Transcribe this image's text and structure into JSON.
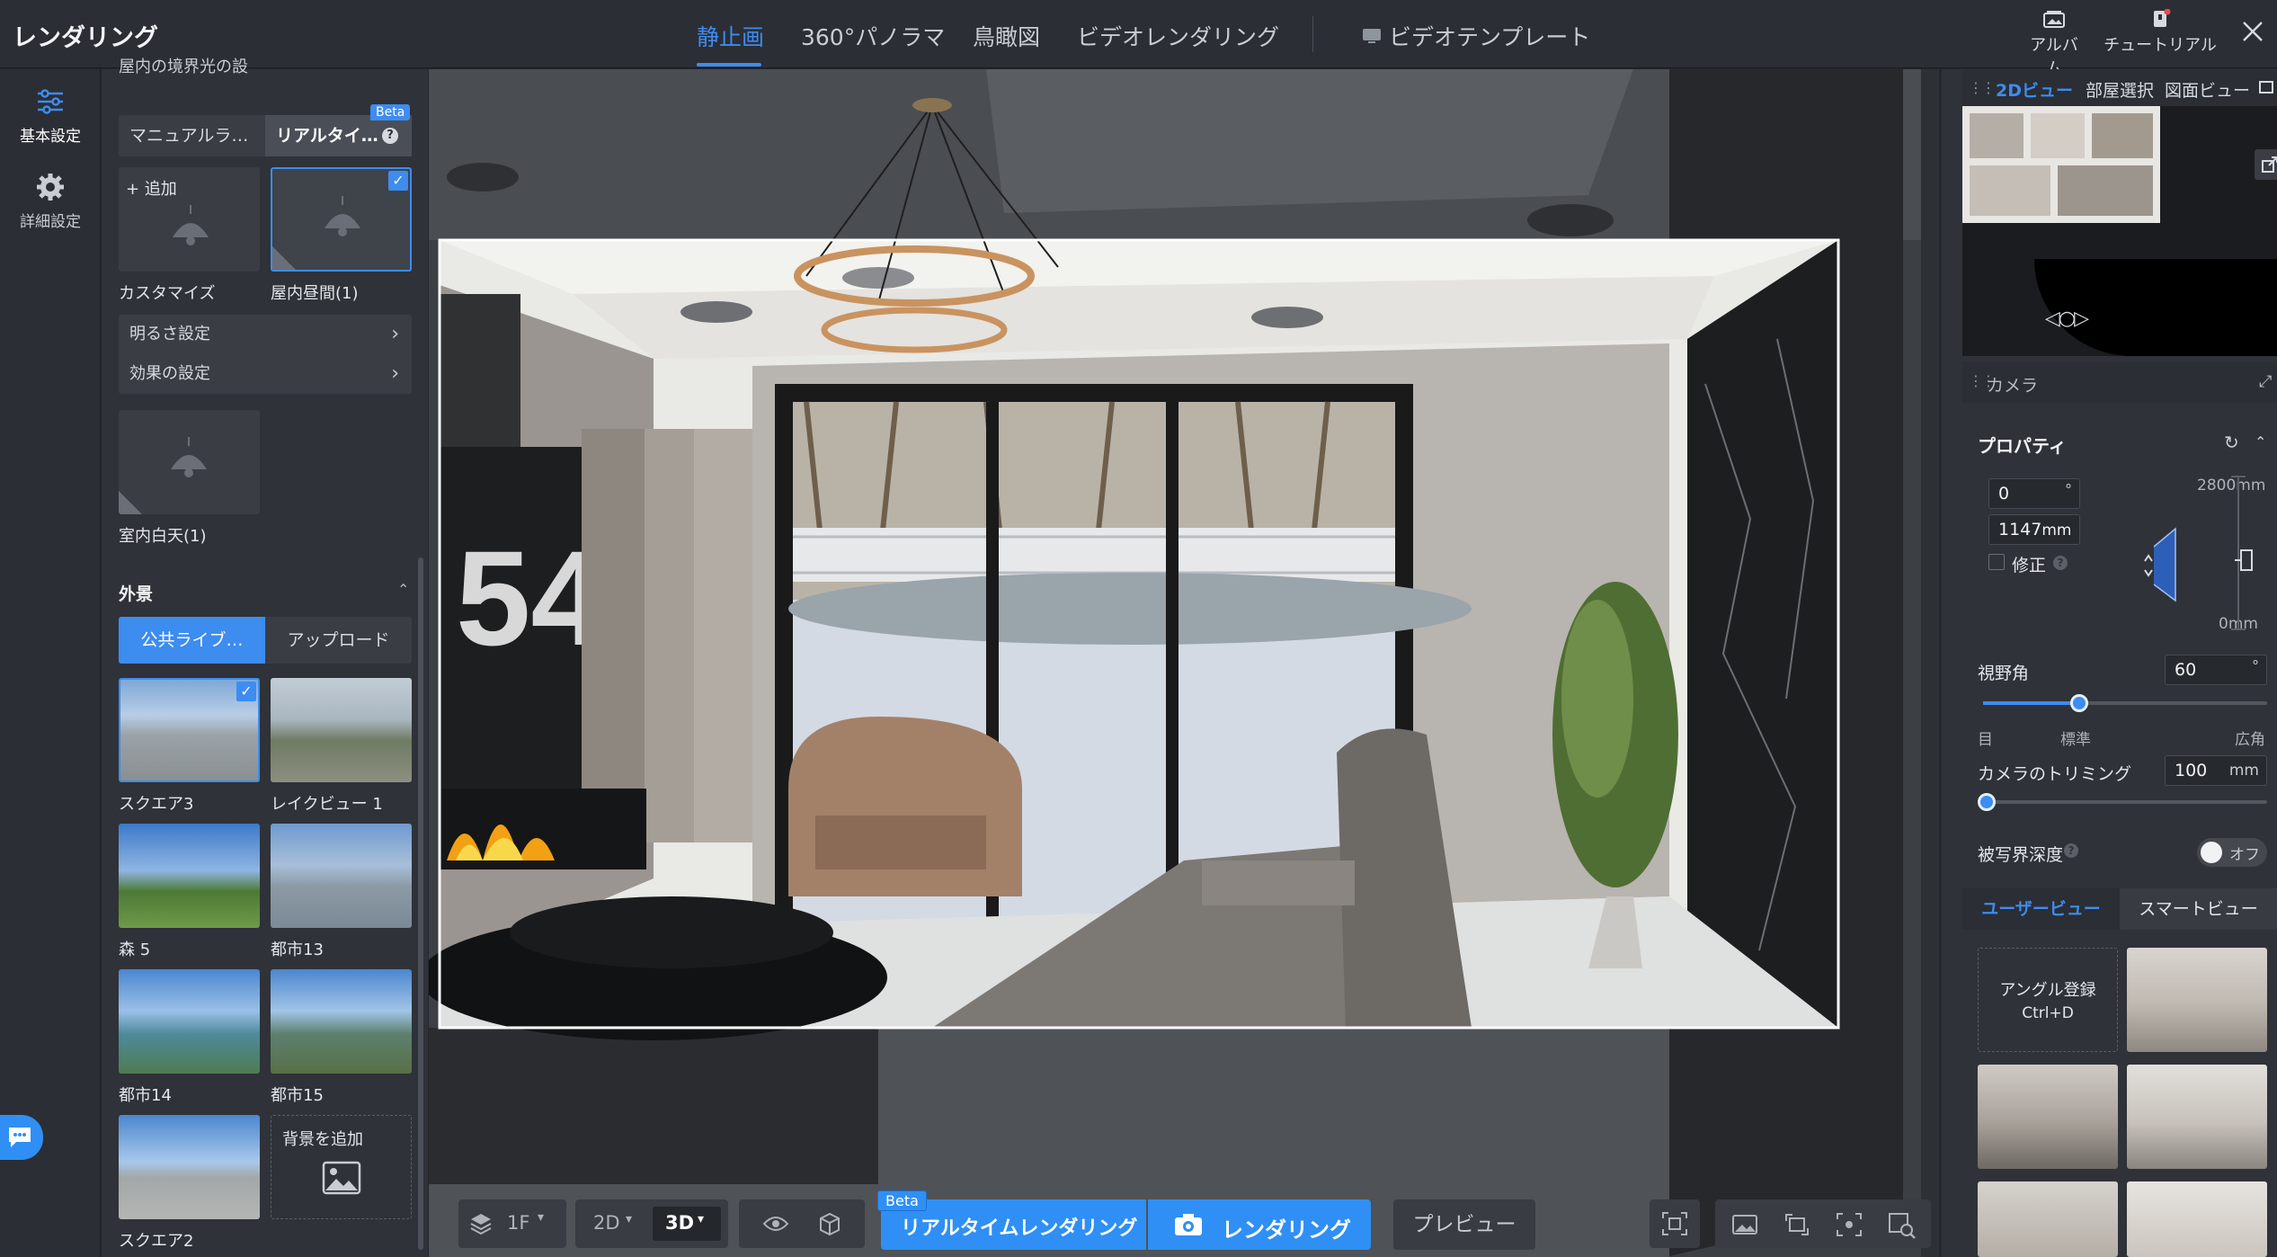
{
  "app": {
    "title": "レンダリング"
  },
  "top_tabs": [
    "静止画",
    "360°パノラマ",
    "鳥瞰図",
    "ビデオレンダリング"
  ],
  "video_template": "ビデオテンプレート",
  "top_right": {
    "album": "アルバム",
    "tutorial": "チュートリアル"
  },
  "rail": {
    "basic": "基本設定",
    "advanced": "詳細設定"
  },
  "left_panel": {
    "cut_heading": "屋内の境界光の設",
    "light_modes": {
      "manual": "マニュアルラ…",
      "realtime": "リアルタイ…",
      "beta": "Beta"
    },
    "add_label": "+ 追加",
    "presets": [
      {
        "label": "カスタマイズ"
      },
      {
        "label": "屋内昼間(1)"
      },
      {
        "label": "室内白天(1)"
      }
    ],
    "menus": [
      "明るさ設定",
      "効果の設定"
    ],
    "exterior_heading": "外景",
    "exterior_tabs": {
      "public": "公共ライブ…",
      "upload": "アップロード"
    },
    "backgrounds": [
      {
        "label": "スクエア3"
      },
      {
        "label": "レイクビュー 1"
      },
      {
        "label": "森 5"
      },
      {
        "label": "都市13"
      },
      {
        "label": "都市14"
      },
      {
        "label": "都市15"
      },
      {
        "label": "スクエア2"
      }
    ],
    "add_background": "背景を追加"
  },
  "right_panel": {
    "view_tabs": [
      "2Dビュー",
      "部屋選択",
      "図面ビュー"
    ],
    "camera_heading": "カメラ",
    "properties_heading": "プロパティ",
    "angle_value": "0",
    "angle_unit": "°",
    "height_value": "1147",
    "height_unit": "mm",
    "top_height": "2800mm",
    "bottom_height": "0mm",
    "correction_label": "修正",
    "fov_label": "視野角",
    "fov_value": "60",
    "fov_unit": "°",
    "fov_fraction": 0.34,
    "fov_marks": [
      "目",
      "標準",
      "広角"
    ],
    "trim_label": "カメラのトリミング",
    "trim_value": "100",
    "trim_unit": "mm",
    "trim_fraction": 0.0,
    "dof_label": "被写界深度",
    "dof_toggle": "オフ",
    "view_mode_tabs": {
      "user": "ユーザービュー",
      "smart": "スマートビュー"
    },
    "register_angle": "アングル登録",
    "register_shortcut": "Ctrl+D"
  },
  "bottom_bar": {
    "floor": "1F",
    "mode_2d": "2D",
    "mode_3d": "3D",
    "beta": "Beta",
    "realtime_render": "リアルタイムレンダリング",
    "render": "レンダリング",
    "preview": "プレビュー"
  },
  "scene": {
    "wall_number": "54"
  },
  "colors": {
    "accent": "#3d8cf0",
    "panel": "#2f3238",
    "topbar": "#2b2e34"
  }
}
